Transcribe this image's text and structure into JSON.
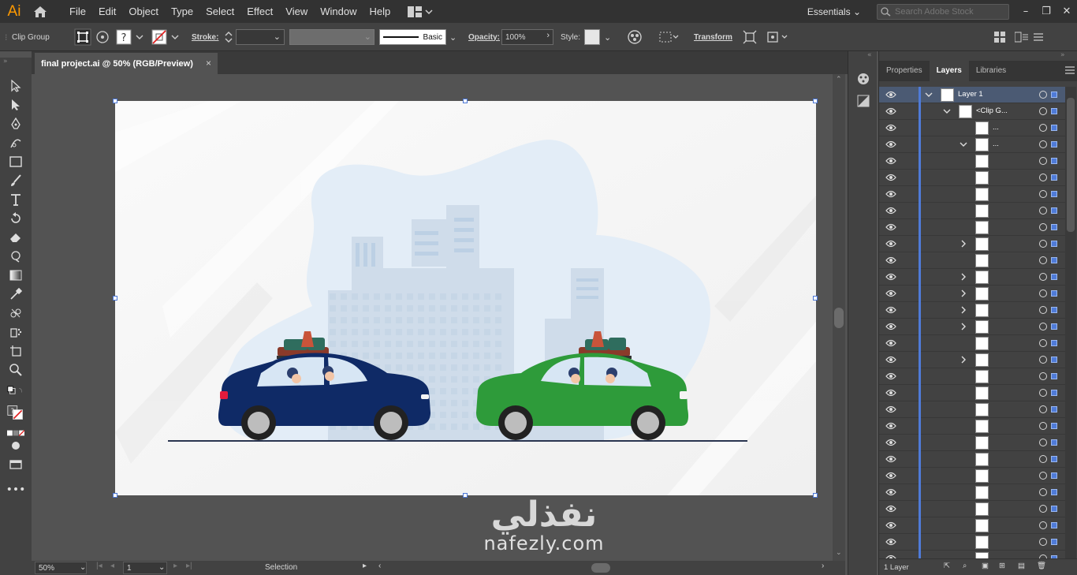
{
  "app": {
    "logo": "Ai"
  },
  "menu": [
    "File",
    "Edit",
    "Object",
    "Type",
    "Select",
    "Effect",
    "View",
    "Window",
    "Help"
  ],
  "workspace": {
    "label": "Essentials",
    "search_placeholder": "Search Adobe Stock"
  },
  "control": {
    "selection_label": "Clip Group",
    "stroke_label": "Stroke:",
    "brush_label": "Basic",
    "opacity_label": "Opacity:",
    "opacity_value": "100%",
    "style_label": "Style:",
    "transform_label": "Transform"
  },
  "document": {
    "tab_title": "final project.ai @ 50% (RGB/Preview)",
    "close": "×"
  },
  "status": {
    "zoom": "50%",
    "artboard": "1",
    "tool": "Selection"
  },
  "panel": {
    "tabs": [
      "Properties",
      "Layers",
      "Libraries"
    ],
    "active_tab": "Layers",
    "footer": "1 Layer",
    "rows": [
      {
        "name": "Layer 1",
        "indent": 0,
        "expanded": true,
        "sel": true
      },
      {
        "name": "<Clip G...",
        "indent": 1,
        "expanded": true
      },
      {
        "name": "...",
        "indent": 2
      },
      {
        "name": "...",
        "indent": 2,
        "expanded": true
      },
      {
        "name": "",
        "indent": 3
      },
      {
        "name": "",
        "indent": 3
      },
      {
        "name": "",
        "indent": 3
      },
      {
        "name": "",
        "indent": 3
      },
      {
        "name": "",
        "indent": 3
      },
      {
        "name": "",
        "indent": 3,
        "collapsed": true
      },
      {
        "name": "",
        "indent": 3
      },
      {
        "name": "",
        "indent": 3,
        "collapsed": true
      },
      {
        "name": "",
        "indent": 3,
        "collapsed": true
      },
      {
        "name": "",
        "indent": 3,
        "collapsed": true
      },
      {
        "name": "",
        "indent": 3,
        "collapsed": true
      },
      {
        "name": "",
        "indent": 3
      },
      {
        "name": "",
        "indent": 3,
        "collapsed": true
      },
      {
        "name": "",
        "indent": 3
      },
      {
        "name": "",
        "indent": 3
      },
      {
        "name": "",
        "indent": 3
      },
      {
        "name": "",
        "indent": 3
      },
      {
        "name": "",
        "indent": 3
      },
      {
        "name": "",
        "indent": 3
      },
      {
        "name": "",
        "indent": 3
      },
      {
        "name": "",
        "indent": 3
      },
      {
        "name": "",
        "indent": 3
      },
      {
        "name": "",
        "indent": 3
      },
      {
        "name": "",
        "indent": 3
      },
      {
        "name": "",
        "indent": 3
      }
    ]
  },
  "watermark": {
    "arabic": "نفذلي",
    "latin": "nafezly.com"
  },
  "colors": {
    "accent": "#4f7bd8",
    "logo": "#ff9a00",
    "car_blue": "#0f2a66",
    "car_green": "#2e9b3a"
  }
}
